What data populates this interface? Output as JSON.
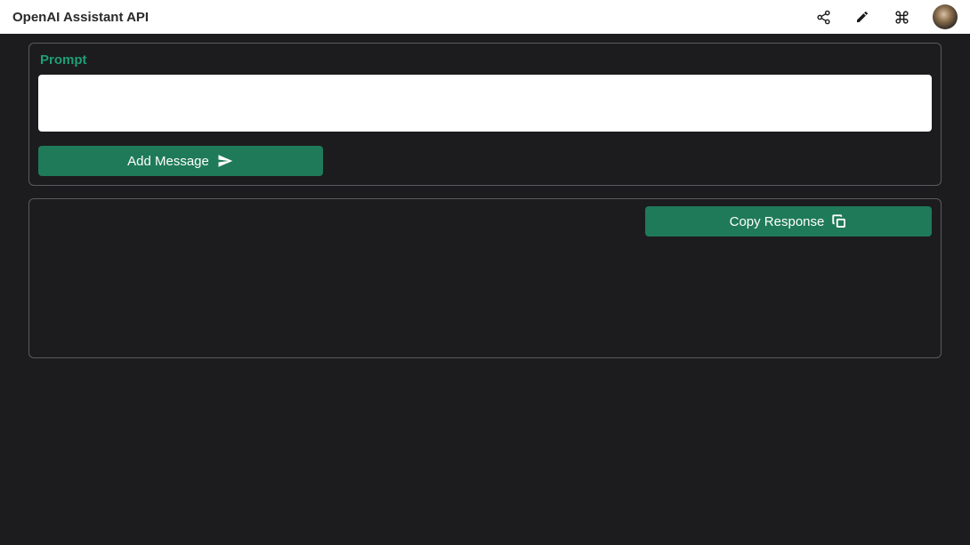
{
  "header": {
    "title": "OpenAI Assistant API"
  },
  "icons": {
    "share": "share-icon",
    "edit": "pencil-icon",
    "command": "command-icon",
    "avatar": "user-avatar"
  },
  "prompt": {
    "label": "Prompt",
    "input_value": "",
    "placeholder": ""
  },
  "buttons": {
    "add_message": "Add Message",
    "copy_response": "Copy Response"
  },
  "response": {
    "content": ""
  },
  "colors": {
    "accent": "#1f7a5a",
    "accent_text": "#1f9e73",
    "background": "#1c1c1e",
    "panel_border": "#5a5a5e"
  }
}
